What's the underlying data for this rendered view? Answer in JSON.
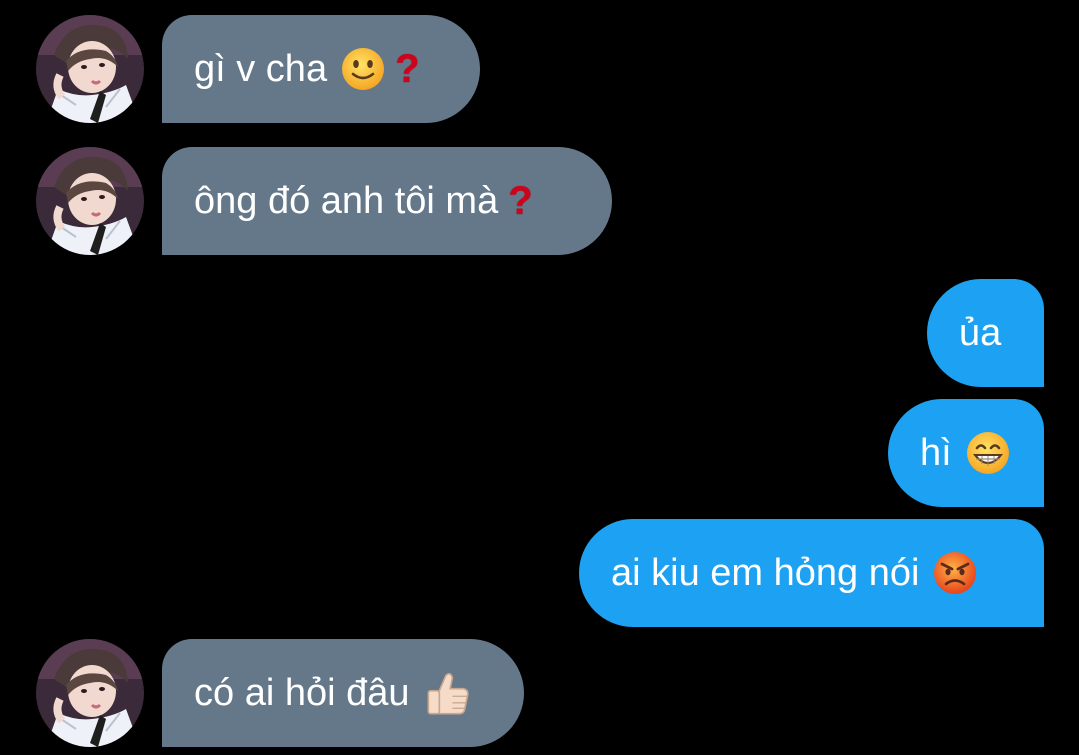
{
  "colors": {
    "background": "#000000",
    "incoming_bubble": "#65788a",
    "outgoing_bubble": "#1da1f2",
    "text": "#ffffff",
    "question_mark": "#d0021b"
  },
  "messages": [
    {
      "direction": "incoming",
      "text": "gì v cha",
      "emojis": [
        "slightly-smiling-face",
        "red-question-mark"
      ]
    },
    {
      "direction": "incoming",
      "text": "ông đó anh tôi mà",
      "emojis": [
        "red-question-mark"
      ]
    },
    {
      "direction": "outgoing",
      "text": "ủa",
      "emojis": []
    },
    {
      "direction": "outgoing",
      "text": "hì",
      "emojis": [
        "grinning-face"
      ]
    },
    {
      "direction": "outgoing",
      "text": "ai kiu em hỏng nói",
      "emojis": [
        "angry-face"
      ]
    },
    {
      "direction": "incoming",
      "text": "có ai hỏi đâu",
      "emojis": [
        "thumbs-up"
      ]
    }
  ],
  "question_mark_glyph": "?"
}
